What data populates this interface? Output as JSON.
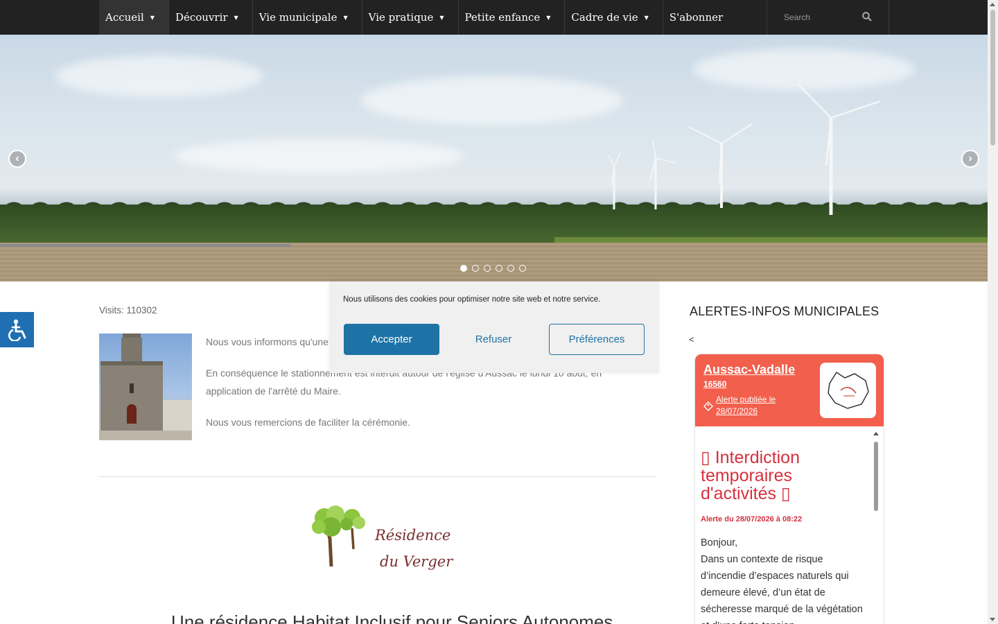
{
  "nav": {
    "items": [
      {
        "label": "Accueil",
        "has_dropdown": true,
        "active": true
      },
      {
        "label": "Découvrir",
        "has_dropdown": true
      },
      {
        "label": "Vie municipale",
        "has_dropdown": true
      },
      {
        "label": "Vie pratique",
        "has_dropdown": true
      },
      {
        "label": "Petite enfance",
        "has_dropdown": true
      },
      {
        "label": "Cadre de vie",
        "has_dropdown": true
      },
      {
        "label": "S'abonner",
        "has_dropdown": false
      }
    ],
    "search_placeholder": "Search",
    "search_icon": "search-icon"
  },
  "slider": {
    "prev_icon": "chevron-left-icon",
    "next_icon": "chevron-right-icon",
    "slide_count": 6,
    "active_slide": 1
  },
  "accessibility": {
    "icon": "wheelchair-icon"
  },
  "main": {
    "visits": "Visits: 110302",
    "article": {
      "p1": "Nous vous informons qu'une",
      "p2": "En conséquence le stationnement est interdit autour de l'église d'Aussac le lundi 10 août, en application de l'arrêté du Maire.",
      "p3": "Nous vous remercions de faciliter la cérémonie."
    },
    "residence_logo": {
      "line1": "Résidence",
      "line2": "du Verger"
    },
    "bottom_heading": "Une résidence Habitat Inclusif pour Seniors Autonomes"
  },
  "cookie": {
    "text": "Nous utilisons des cookies pour optimiser notre site web et notre service.",
    "accept": "Accepter",
    "refuse": "Refuser",
    "preferences": "Préférences"
  },
  "sidebar": {
    "title": "ALERTES-INFOS MUNICIPALES",
    "prev": "<",
    "alert": {
      "town": "Aussac-Vadalle",
      "zip": "16560",
      "published": "Alerte publiée le 28/07/2026",
      "headline": "▯ Interdiction temporaires d'activités ▯",
      "date": "Alerte du 28/07/2026 à 08:22",
      "body": "Bonjour,\nDans un contexte de risque d’incendie d’espaces naturels qui demeure élevé, d’un état de sécheresse marqué de la végétation et d’une forte tension"
    }
  },
  "colors": {
    "nav_bg": "#222222",
    "accent_blue": "#1e73a6",
    "alert_red": "#f25f4c",
    "alert_headline": "#d6303d",
    "access_blue": "#1f6fb2"
  }
}
